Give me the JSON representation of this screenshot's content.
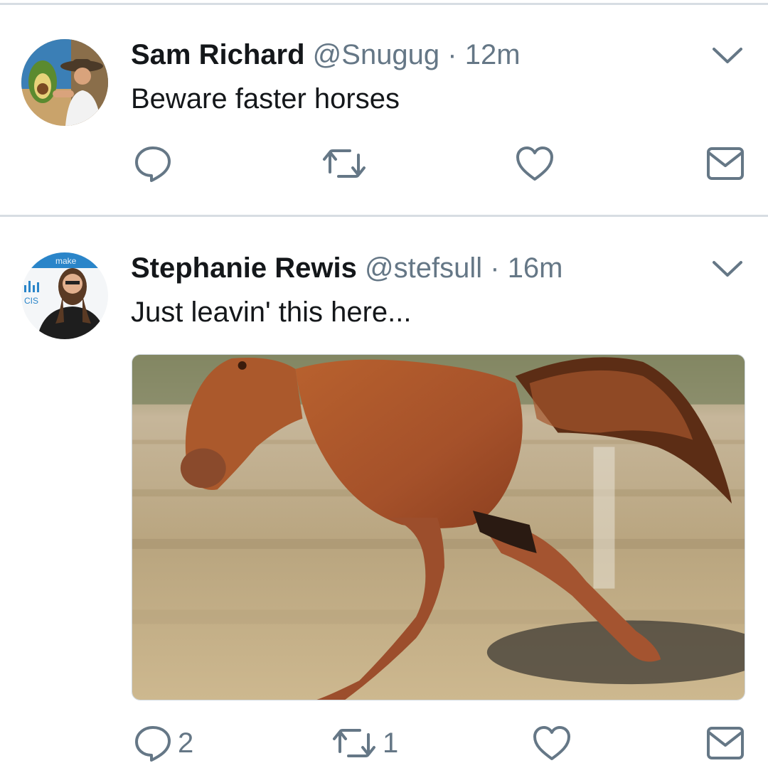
{
  "tweets": [
    {
      "author_name": "Sam Richard",
      "handle": "@Snugug",
      "separator": "·",
      "time": "12m",
      "text": "Beware faster horses",
      "reply_count": "",
      "retweet_count": "",
      "has_media": false
    },
    {
      "author_name": "Stephanie Rewis",
      "handle": "@stefsull",
      "separator": "·",
      "time": "16m",
      "text": "Just leavin' this here...",
      "reply_count": "2",
      "retweet_count": "1",
      "has_media": true
    }
  ],
  "icons": {
    "reply": "reply-icon",
    "retweet": "retweet-icon",
    "like": "heart-icon",
    "dm": "envelope-icon",
    "more": "chevron-down-icon"
  },
  "colors": {
    "text": "#14171a",
    "secondary": "#657786",
    "divider": "#d7dde3"
  }
}
